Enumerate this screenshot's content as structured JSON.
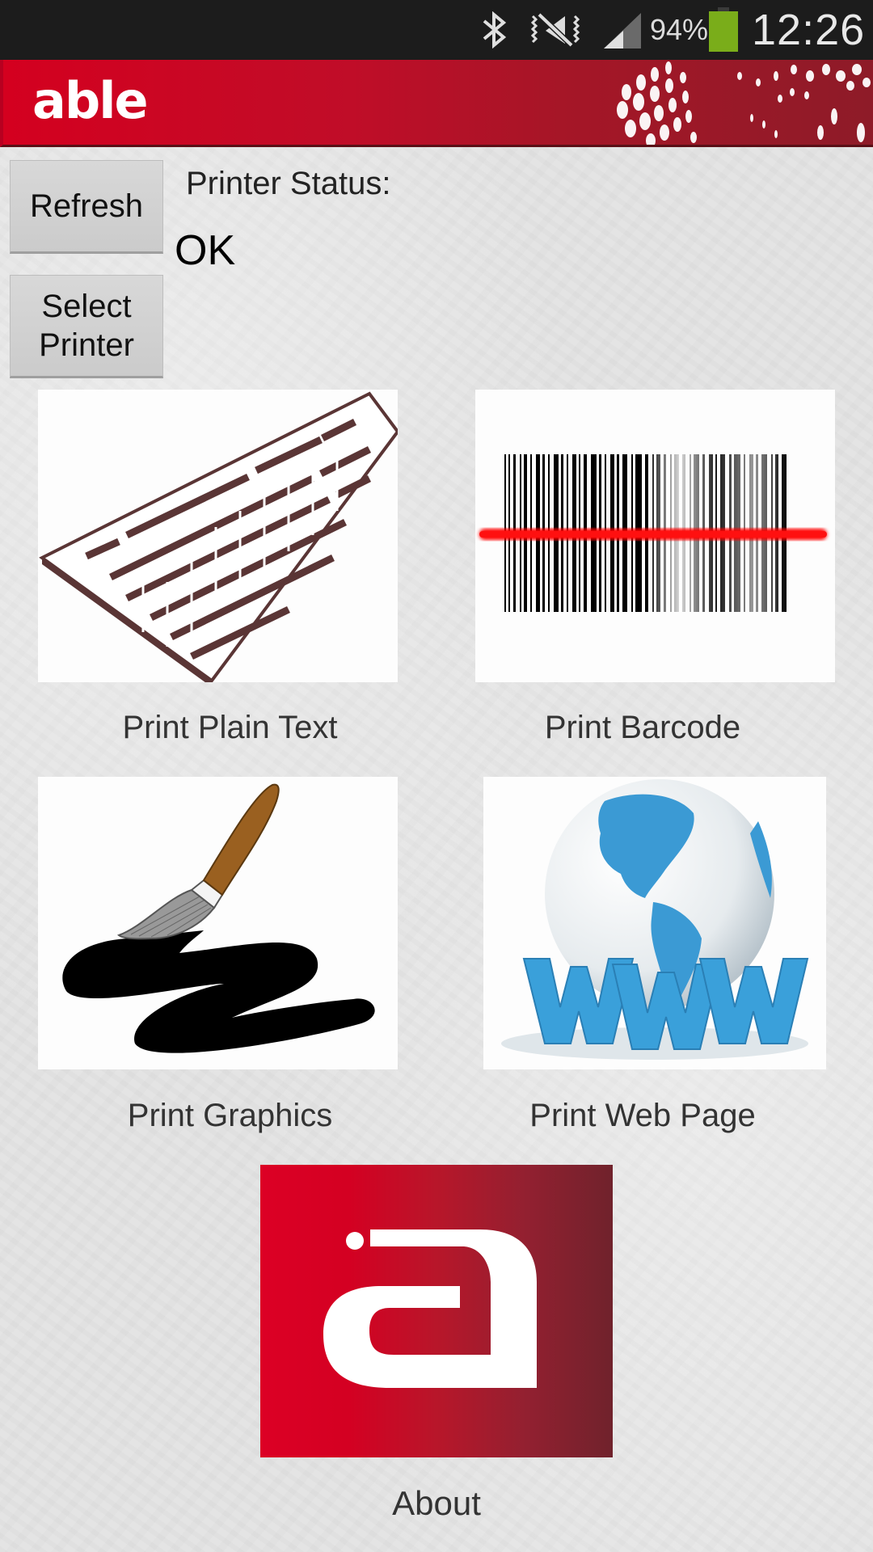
{
  "status_bar": {
    "icons": [
      "bluetooth-icon",
      "mute-vibrate-icon",
      "signal-icon",
      "battery-icon"
    ],
    "battery_percent": "94%",
    "time": "12:26",
    "battery_color": "#7aad1a"
  },
  "app_bar": {
    "logo_text": "able",
    "brand_color": "#d4001f"
  },
  "controls": {
    "refresh_label": "Refresh",
    "select_printer_line1": "Select",
    "select_printer_line2": "Printer",
    "status_label": "Printer Status:",
    "status_value": "OK"
  },
  "tiles": [
    {
      "label": "Print Plain Text",
      "icon": "keyboard-icon"
    },
    {
      "label": "Print Barcode",
      "icon": "barcode-icon"
    },
    {
      "label": "Print Graphics",
      "icon": "paintbrush-icon"
    },
    {
      "label": "Print Web Page",
      "icon": "globe-www-icon"
    }
  ],
  "about": {
    "label": "About",
    "icon": "able-logo-icon"
  }
}
